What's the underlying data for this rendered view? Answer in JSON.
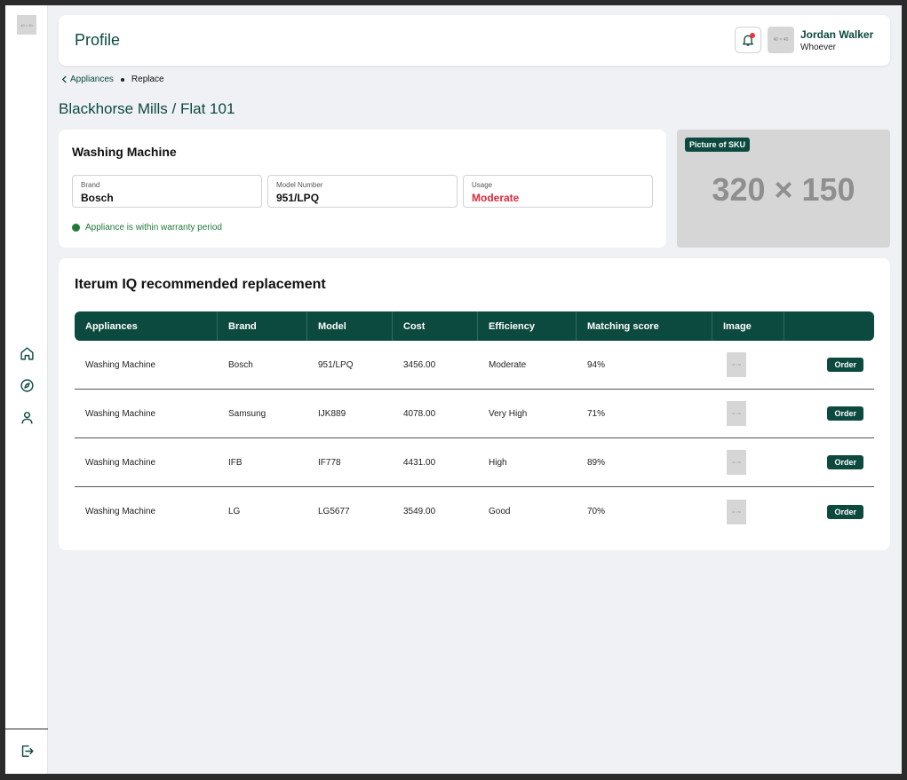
{
  "sidebar": {
    "logo_text": "40 × 40",
    "nav": [
      {
        "name": "home-icon"
      },
      {
        "name": "compass-icon"
      },
      {
        "name": "user-icon"
      }
    ],
    "logout_icon": "logout-icon"
  },
  "header": {
    "title": "Profile",
    "avatar_text": "40 × 40",
    "user_name": "Jordan Walker",
    "user_role": "Whoever",
    "notification_dot_color": "#e53935"
  },
  "breadcrumb": {
    "parent": "Appliances",
    "current": "Replace"
  },
  "property_title": "Blackhorse Mills / Flat 101",
  "appliance": {
    "name": "Washing Machine",
    "fields": [
      {
        "label": "Brand",
        "value": "Bosch"
      },
      {
        "label": "Model Number",
        "value": "951/LPQ"
      },
      {
        "label": "Usage",
        "value": "Moderate"
      }
    ],
    "warranty_text": "Appliance is within warranty period"
  },
  "sku": {
    "tag": "Picture of SKU",
    "placeholder": "320 × 150"
  },
  "recommendation": {
    "title": "Iterum IQ recommended replacement",
    "columns": [
      "Appliances",
      "Brand",
      "Model",
      "Cost",
      "Efficiency",
      "Matching score",
      "Image",
      ""
    ],
    "rows": [
      {
        "appliance": "Washing Machine",
        "brand": "Bosch",
        "model": "951/LPQ",
        "cost": "3456.00",
        "efficiency": "Moderate",
        "score": "94%",
        "thumb": "40 × 56",
        "action": "Order"
      },
      {
        "appliance": "Washing Machine",
        "brand": "Samsung",
        "model": "IJK889",
        "cost": "4078.00",
        "efficiency": "Very High",
        "score": "71%",
        "thumb": "40 × 56",
        "action": "Order"
      },
      {
        "appliance": "Washing Machine",
        "brand": "IFB",
        "model": "IF778",
        "cost": "4431.00",
        "efficiency": "High",
        "score": "89%",
        "thumb": "40 × 56",
        "action": "Order"
      },
      {
        "appliance": "Washing Machine",
        "brand": "LG",
        "model": "LG5677",
        "cost": "3549.00",
        "efficiency": "Good",
        "score": "70%",
        "thumb": "40 × 56",
        "action": "Order"
      }
    ]
  },
  "colors": {
    "brand": "#0c4a3f",
    "warning": "#e0283a",
    "success": "#1f7a3a"
  }
}
